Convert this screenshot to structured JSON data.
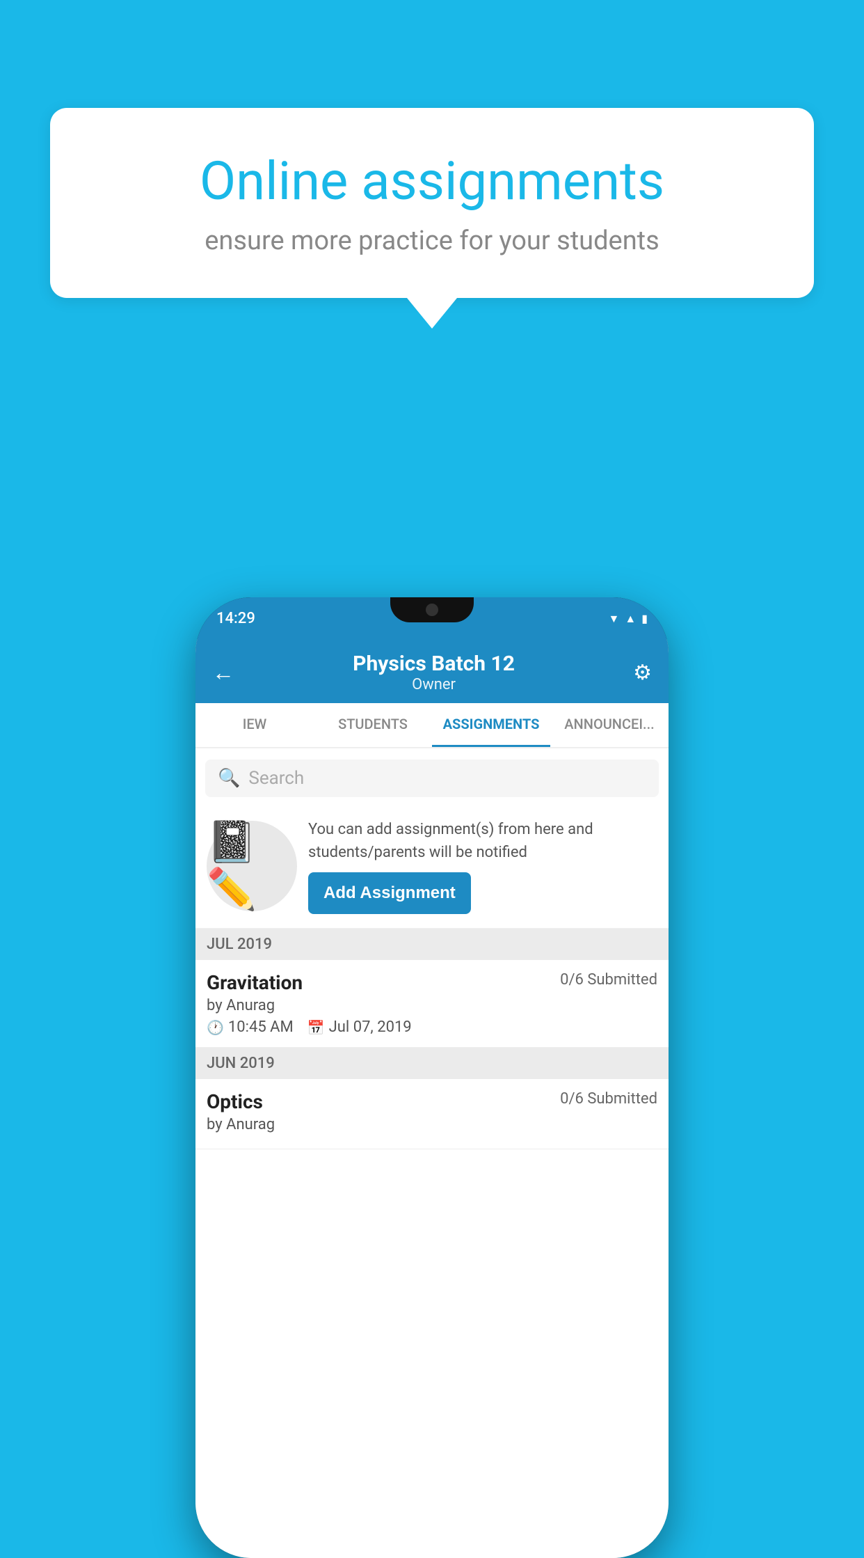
{
  "background_color": "#1ab8e8",
  "speech_bubble": {
    "title": "Online assignments",
    "subtitle": "ensure more practice for your students"
  },
  "phone": {
    "status_bar": {
      "time": "14:29",
      "icons": [
        "wifi",
        "signal",
        "battery"
      ]
    },
    "header": {
      "title": "Physics Batch 12",
      "subtitle": "Owner",
      "back_label": "←",
      "settings_label": "⚙"
    },
    "tabs": [
      {
        "label": "IEW",
        "active": false
      },
      {
        "label": "STUDENTS",
        "active": false
      },
      {
        "label": "ASSIGNMENTS",
        "active": true
      },
      {
        "label": "ANNOUNCEM...",
        "active": false
      }
    ],
    "search": {
      "placeholder": "Search"
    },
    "promo": {
      "icon": "📓",
      "text": "You can add assignment(s) from here and students/parents will be notified",
      "button_label": "Add Assignment"
    },
    "sections": [
      {
        "header": "JUL 2019",
        "assignments": [
          {
            "name": "Gravitation",
            "submitted": "0/6 Submitted",
            "by": "by Anurag",
            "time": "10:45 AM",
            "date": "Jul 07, 2019"
          }
        ]
      },
      {
        "header": "JUN 2019",
        "assignments": [
          {
            "name": "Optics",
            "submitted": "0/6 Submitted",
            "by": "by Anurag",
            "time": "",
            "date": ""
          }
        ]
      }
    ]
  }
}
